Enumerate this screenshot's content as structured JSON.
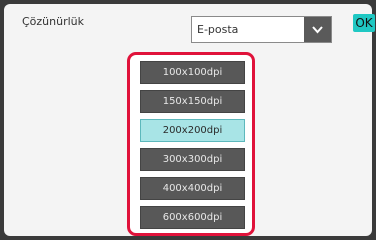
{
  "resolution": {
    "label": "Çözünürlük"
  },
  "format_select": {
    "value": "E-posta",
    "arrow_icon": "chevron-down-icon"
  },
  "ok_button": {
    "label": "OK"
  },
  "resolution_options": [
    {
      "label": "100x100dpi",
      "selected": false
    },
    {
      "label": "150x150dpi",
      "selected": false
    },
    {
      "label": "200x200dpi",
      "selected": true
    },
    {
      "label": "300x300dpi",
      "selected": false
    },
    {
      "label": "400x400dpi",
      "selected": false
    },
    {
      "label": "600x600dpi",
      "selected": false
    }
  ],
  "colors": {
    "highlight_border": "#e0123a",
    "selected_option": "#a8e4e6",
    "ok_accent": "#1fc8c3"
  }
}
